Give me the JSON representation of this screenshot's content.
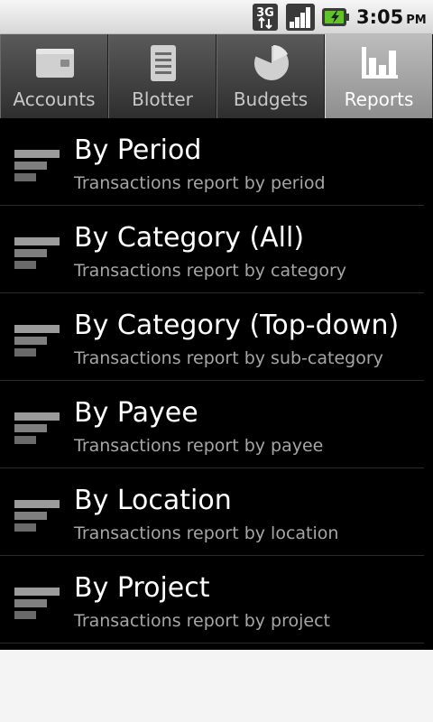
{
  "status_bar": {
    "network_label": "3G",
    "time": "3:05",
    "ampm": "PM"
  },
  "tabs": [
    {
      "label": "Accounts",
      "icon": "wallet-icon",
      "active": false
    },
    {
      "label": "Blotter",
      "icon": "document-list-icon",
      "active": false
    },
    {
      "label": "Budgets",
      "icon": "pie-chart-icon",
      "active": false
    },
    {
      "label": "Reports",
      "icon": "bar-chart-icon",
      "active": true
    }
  ],
  "reports": [
    {
      "title": "By Period",
      "subtitle": "Transactions report by period"
    },
    {
      "title": "By Category (All)",
      "subtitle": "Transactions report by category"
    },
    {
      "title": "By Category (Top-down)",
      "subtitle": "Transactions report by sub-category"
    },
    {
      "title": "By Payee",
      "subtitle": "Transactions report by payee"
    },
    {
      "title": "By Location",
      "subtitle": "Transactions report by location"
    },
    {
      "title": "By Project",
      "subtitle": "Transactions report by project"
    }
  ],
  "colors": {
    "list_background": "#000000",
    "title_text": "#ffffff",
    "subtitle_text": "#a6a6a6",
    "active_tab": "#a8a8a8"
  }
}
